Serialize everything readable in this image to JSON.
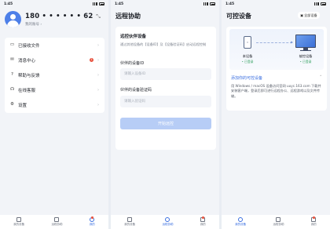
{
  "status_bar": {
    "time": "1:45"
  },
  "profile": {
    "phone": "180 • • • • • • 62",
    "account_label": "我的账号 ›"
  },
  "menu": {
    "items": [
      {
        "label": "已接收文件",
        "icon": "folder-icon"
      },
      {
        "label": "消息中心",
        "icon": "mail-icon",
        "badge": "1"
      },
      {
        "label": "帮助与反馈",
        "icon": "help-icon"
      },
      {
        "label": "在线客服",
        "icon": "headset-icon"
      },
      {
        "label": "设置",
        "icon": "gear-icon"
      }
    ]
  },
  "remote_assist": {
    "title": "远程协助",
    "card_title": "远控伙伴设备",
    "description": "通过其他设备的【设备ID】及【设备验证码】启动远程控制",
    "device_id_label": "伙伴的设备ID",
    "device_id_placeholder": "请输入设备ID",
    "code_label": "伙伴的设备验证码",
    "code_placeholder": "请输入验证码",
    "start_button": "开始远控"
  },
  "controllable": {
    "title": "可控设备",
    "all_devices_button": "全部设备",
    "this_device_label": "本设备",
    "this_device_status": "• 已登录",
    "controlled_label": "被控设备",
    "controlled_status": "• 已登录",
    "add_link": "添加你的可控设备",
    "description": "用 Windows / macOS 设备访问官网 uuyc.163.com 下载并安装客户端，登录后即可进行远程办公、远程游戏以及文件传输。"
  },
  "tabs": {
    "screen1": [
      {
        "label": "我的设备"
      },
      {
        "label": "远程协助"
      },
      {
        "label": "我的"
      }
    ],
    "screen2": [
      {
        "label": "我的设备"
      },
      {
        "label": "远程协助"
      },
      {
        "label": "我的"
      }
    ],
    "screen3": [
      {
        "label": "我的设备"
      },
      {
        "label": "远程协助"
      },
      {
        "label": "我的"
      }
    ]
  },
  "colors": {
    "accent": "#3b6fe0",
    "badge": "#e8533f",
    "disabled_button": "#b7cdf6",
    "background": "#f2f4f8"
  }
}
